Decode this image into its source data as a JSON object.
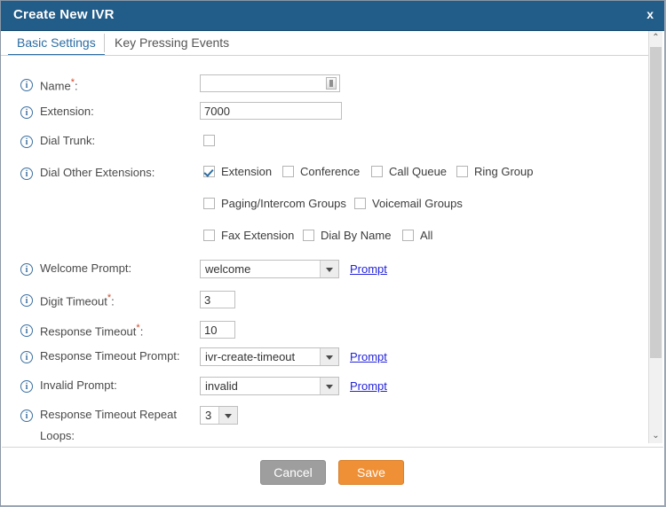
{
  "window": {
    "title": "Create New IVR",
    "close_label": "x"
  },
  "tabs": [
    {
      "label": "Basic Settings",
      "active": true
    },
    {
      "label": "Key Pressing Events",
      "active": false
    }
  ],
  "form": {
    "name": {
      "label": "Name",
      "required": "*",
      "value": "",
      "placeholder": ""
    },
    "extension": {
      "label": "Extension",
      "value": "7000"
    },
    "dial_trunk": {
      "label": "Dial Trunk",
      "checked": false
    },
    "dial_other_extensions": {
      "label": "Dial Other Extensions",
      "options": [
        {
          "label": "Extension",
          "checked": true
        },
        {
          "label": "Conference",
          "checked": false
        },
        {
          "label": "Call Queue",
          "checked": false
        },
        {
          "label": "Ring Group",
          "checked": false
        },
        {
          "label": "Paging/Intercom Groups",
          "checked": false
        },
        {
          "label": "Voicemail Groups",
          "checked": false
        },
        {
          "label": "Fax Extension",
          "checked": false
        },
        {
          "label": "Dial By Name",
          "checked": false
        },
        {
          "label": "All",
          "checked": false
        }
      ]
    },
    "welcome_prompt": {
      "label": "Welcome Prompt",
      "value": "welcome",
      "link": "Prompt"
    },
    "digit_timeout": {
      "label": "Digit Timeout",
      "required": "*",
      "value": "3"
    },
    "response_timeout": {
      "label": "Response Timeout",
      "required": "*",
      "value": "10"
    },
    "response_timeout_prompt": {
      "label": "Response Timeout Prompt",
      "value": "ivr-create-timeout",
      "link": "Prompt"
    },
    "invalid_prompt": {
      "label": "Invalid Prompt",
      "value": "invalid",
      "link": "Prompt"
    },
    "response_timeout_repeat_loops": {
      "label_line1": "Response Timeout Repeat",
      "label_line2": "Loops:",
      "value": "3"
    }
  },
  "footer": {
    "cancel_label": "Cancel",
    "save_label": "Save"
  },
  "icons": {
    "info": "i",
    "scroll_up": "⌃",
    "scroll_down": "⌄"
  },
  "colors": {
    "titlebar": "#225c88",
    "accent": "#2b6ca3",
    "save": "#ef9036",
    "cancel": "#9e9e9e",
    "link": "#2222dd"
  }
}
